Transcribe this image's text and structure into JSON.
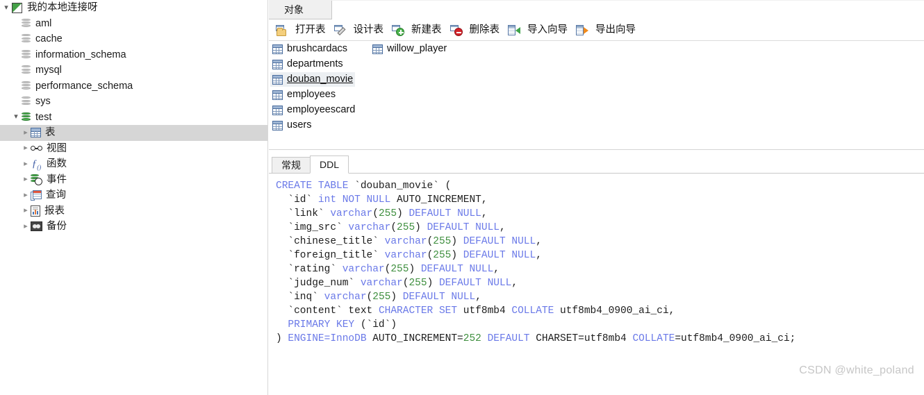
{
  "sidebar": {
    "connection": {
      "label": "我的本地连接呀",
      "icon": "connection-icon",
      "expanded": true
    },
    "databases": [
      {
        "label": "aml",
        "icon": "database-icon",
        "active": false
      },
      {
        "label": "cache",
        "icon": "database-icon",
        "active": false
      },
      {
        "label": "information_schema",
        "icon": "database-icon",
        "active": false
      },
      {
        "label": "mysql",
        "icon": "database-icon",
        "active": false
      },
      {
        "label": "performance_schema",
        "icon": "database-icon",
        "active": false
      },
      {
        "label": "sys",
        "icon": "database-icon",
        "active": false
      },
      {
        "label": "test",
        "icon": "database-icon",
        "active": true,
        "expanded": true
      }
    ],
    "test_children": [
      {
        "label": "表",
        "icon": "table-grid-icon",
        "selected": true
      },
      {
        "label": "视图",
        "icon": "view-glasses-icon",
        "selected": false
      },
      {
        "label": "函数",
        "icon": "function-fx-icon",
        "selected": false
      },
      {
        "label": "事件",
        "icon": "event-clock-icon",
        "selected": false
      },
      {
        "label": "查询",
        "icon": "query-icon",
        "selected": false
      },
      {
        "label": "报表",
        "icon": "report-icon",
        "selected": false
      },
      {
        "label": "备份",
        "icon": "backup-icon",
        "selected": false
      }
    ]
  },
  "main": {
    "top_tab": {
      "label": "对象"
    },
    "toolbar": [
      {
        "label": "打开表",
        "icon": "open-table-icon"
      },
      {
        "label": "设计表",
        "icon": "design-table-icon"
      },
      {
        "label": "新建表",
        "icon": "new-table-icon"
      },
      {
        "label": "删除表",
        "icon": "delete-table-icon"
      },
      {
        "label": "导入向导",
        "icon": "import-wizard-icon"
      },
      {
        "label": "导出向导",
        "icon": "export-wizard-icon"
      }
    ],
    "tables": [
      {
        "label": "brushcardacs",
        "col": 0,
        "row": 0,
        "selected": false
      },
      {
        "label": "departments",
        "col": 0,
        "row": 1,
        "selected": false
      },
      {
        "label": "douban_movie",
        "col": 0,
        "row": 2,
        "selected": true
      },
      {
        "label": "employees",
        "col": 0,
        "row": 3,
        "selected": false
      },
      {
        "label": "employeescard",
        "col": 0,
        "row": 4,
        "selected": false
      },
      {
        "label": "users",
        "col": 0,
        "row": 5,
        "selected": false
      },
      {
        "label": "willow_player",
        "col": 1,
        "row": 0,
        "selected": false
      }
    ],
    "sub_tabs": [
      {
        "label": "常规",
        "active": false
      },
      {
        "label": "DDL",
        "active": true
      }
    ],
    "ddl_lines": [
      [
        {
          "t": "CREATE TABLE ",
          "c": "kw"
        },
        {
          "t": "`douban_movie` (",
          "c": "pl"
        }
      ],
      [
        {
          "t": "  `id` ",
          "c": "pl"
        },
        {
          "t": "int NOT NULL ",
          "c": "kw"
        },
        {
          "t": "AUTO_INCREMENT,",
          "c": "pl"
        }
      ],
      [
        {
          "t": "  `link` ",
          "c": "pl"
        },
        {
          "t": "varchar",
          "c": "kw"
        },
        {
          "t": "(",
          "c": "pl"
        },
        {
          "t": "255",
          "c": "num"
        },
        {
          "t": ") ",
          "c": "pl"
        },
        {
          "t": "DEFAULT NULL",
          "c": "kw"
        },
        {
          "t": ",",
          "c": "pl"
        }
      ],
      [
        {
          "t": "  `img_src` ",
          "c": "pl"
        },
        {
          "t": "varchar",
          "c": "kw"
        },
        {
          "t": "(",
          "c": "pl"
        },
        {
          "t": "255",
          "c": "num"
        },
        {
          "t": ") ",
          "c": "pl"
        },
        {
          "t": "DEFAULT NULL",
          "c": "kw"
        },
        {
          "t": ",",
          "c": "pl"
        }
      ],
      [
        {
          "t": "  `chinese_title` ",
          "c": "pl"
        },
        {
          "t": "varchar",
          "c": "kw"
        },
        {
          "t": "(",
          "c": "pl"
        },
        {
          "t": "255",
          "c": "num"
        },
        {
          "t": ") ",
          "c": "pl"
        },
        {
          "t": "DEFAULT NULL",
          "c": "kw"
        },
        {
          "t": ",",
          "c": "pl"
        }
      ],
      [
        {
          "t": "  `foreign_title` ",
          "c": "pl"
        },
        {
          "t": "varchar",
          "c": "kw"
        },
        {
          "t": "(",
          "c": "pl"
        },
        {
          "t": "255",
          "c": "num"
        },
        {
          "t": ") ",
          "c": "pl"
        },
        {
          "t": "DEFAULT NULL",
          "c": "kw"
        },
        {
          "t": ",",
          "c": "pl"
        }
      ],
      [
        {
          "t": "  `rating` ",
          "c": "pl"
        },
        {
          "t": "varchar",
          "c": "kw"
        },
        {
          "t": "(",
          "c": "pl"
        },
        {
          "t": "255",
          "c": "num"
        },
        {
          "t": ") ",
          "c": "pl"
        },
        {
          "t": "DEFAULT NULL",
          "c": "kw"
        },
        {
          "t": ",",
          "c": "pl"
        }
      ],
      [
        {
          "t": "  `judge_num` ",
          "c": "pl"
        },
        {
          "t": "varchar",
          "c": "kw"
        },
        {
          "t": "(",
          "c": "pl"
        },
        {
          "t": "255",
          "c": "num"
        },
        {
          "t": ") ",
          "c": "pl"
        },
        {
          "t": "DEFAULT NULL",
          "c": "kw"
        },
        {
          "t": ",",
          "c": "pl"
        }
      ],
      [
        {
          "t": "  `inq` ",
          "c": "pl"
        },
        {
          "t": "varchar",
          "c": "kw"
        },
        {
          "t": "(",
          "c": "pl"
        },
        {
          "t": "255",
          "c": "num"
        },
        {
          "t": ") ",
          "c": "pl"
        },
        {
          "t": "DEFAULT NULL",
          "c": "kw"
        },
        {
          "t": ",",
          "c": "pl"
        }
      ],
      [
        {
          "t": "  `content` text ",
          "c": "pl"
        },
        {
          "t": "CHARACTER SET ",
          "c": "kw"
        },
        {
          "t": "utf8mb4 ",
          "c": "pl"
        },
        {
          "t": "COLLATE ",
          "c": "kw"
        },
        {
          "t": "utf8mb4_0900_ai_ci,",
          "c": "pl"
        }
      ],
      [
        {
          "t": "  PRIMARY KEY ",
          "c": "kw"
        },
        {
          "t": "(`id`)",
          "c": "pl"
        }
      ],
      [
        {
          "t": ") ",
          "c": "pl"
        },
        {
          "t": "ENGINE=InnoDB ",
          "c": "kw"
        },
        {
          "t": "AUTO_INCREMENT=",
          "c": "pl"
        },
        {
          "t": "252",
          "c": "num"
        },
        {
          "t": " DEFAULT ",
          "c": "kw"
        },
        {
          "t": "CHARSET=utf8mb4 ",
          "c": "pl"
        },
        {
          "t": "COLLATE",
          "c": "kw"
        },
        {
          "t": "=utf8mb4_0900_ai_ci;",
          "c": "pl"
        }
      ]
    ]
  },
  "watermark": {
    "text": "CSDN @white_poland"
  },
  "colors": {
    "keyword": "#6a79e8",
    "number": "#3f8f3f",
    "plain": "#1c1c1c",
    "selection": "#d6d6d6",
    "table_selection": "#eceff2",
    "accent_green": "#4cb050"
  }
}
